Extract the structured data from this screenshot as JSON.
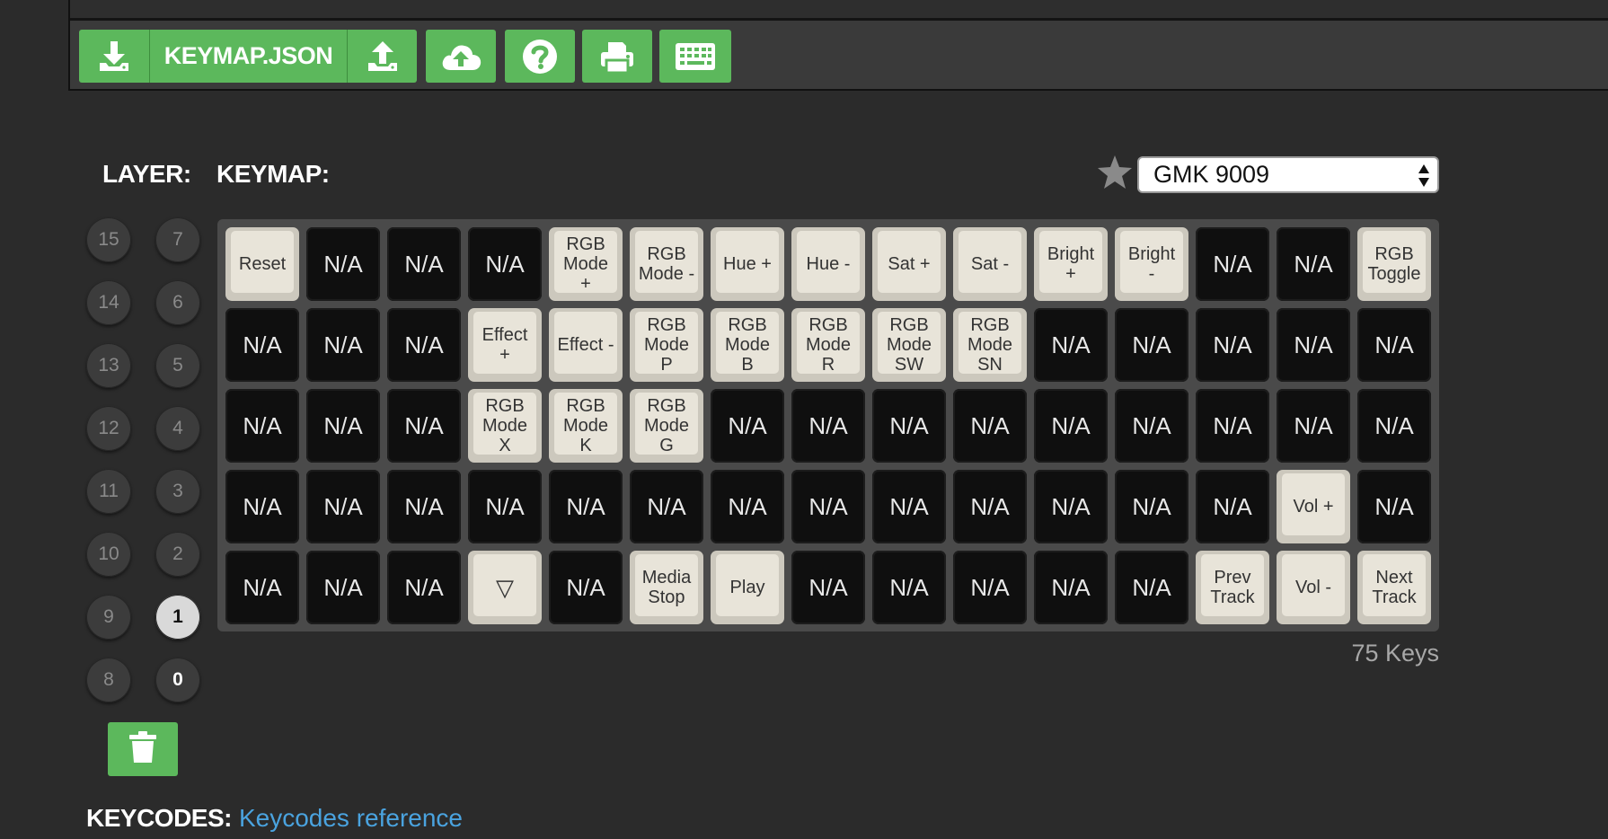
{
  "toolbar": {
    "download_icon": "download-icon",
    "file_label": "KEYMAP.JSON",
    "upload_icon": "upload-icon",
    "cloud_icon": "cloud-upload-icon",
    "help_icon": "question-icon",
    "print_icon": "print-icon",
    "keyboard_icon": "keyboard-icon",
    "accent_color": "#5cb85c"
  },
  "layer_section": {
    "heading": "LAYER:",
    "layers_left": [
      "15",
      "14",
      "13",
      "12",
      "11",
      "10",
      "9",
      "8"
    ],
    "layers_right": [
      "7",
      "6",
      "5",
      "4",
      "3",
      "2",
      "1",
      "0"
    ],
    "selected_layer": "1",
    "trash_icon": "trash-icon"
  },
  "keymap_section": {
    "heading": "KEYMAP:",
    "favorite_icon": "star-icon",
    "keyboard_select_value": "GMK 9009",
    "key_count": "75 Keys",
    "rows": [
      [
        {
          "label": "Reset",
          "style": "light"
        },
        {
          "label": "N/A",
          "style": "dark"
        },
        {
          "label": "N/A",
          "style": "dark"
        },
        {
          "label": "N/A",
          "style": "dark"
        },
        {
          "label": "RGB\nMode\n+",
          "style": "light"
        },
        {
          "label": "RGB\nMode -",
          "style": "light"
        },
        {
          "label": "Hue +",
          "style": "light"
        },
        {
          "label": "Hue -",
          "style": "light"
        },
        {
          "label": "Sat +",
          "style": "light"
        },
        {
          "label": "Sat -",
          "style": "light"
        },
        {
          "label": "Bright\n+",
          "style": "light"
        },
        {
          "label": "Bright\n-",
          "style": "light"
        },
        {
          "label": "N/A",
          "style": "dark"
        },
        {
          "label": "N/A",
          "style": "dark"
        },
        {
          "label": "RGB\nToggle",
          "style": "light"
        }
      ],
      [
        {
          "label": "N/A",
          "style": "dark"
        },
        {
          "label": "N/A",
          "style": "dark"
        },
        {
          "label": "N/A",
          "style": "dark"
        },
        {
          "label": "Effect\n+",
          "style": "light"
        },
        {
          "label": "Effect -",
          "style": "light"
        },
        {
          "label": "RGB\nMode\nP",
          "style": "light"
        },
        {
          "label": "RGB\nMode\nB",
          "style": "light"
        },
        {
          "label": "RGB\nMode\nR",
          "style": "light"
        },
        {
          "label": "RGB\nMode\nSW",
          "style": "light"
        },
        {
          "label": "RGB\nMode\nSN",
          "style": "light"
        },
        {
          "label": "N/A",
          "style": "dark"
        },
        {
          "label": "N/A",
          "style": "dark"
        },
        {
          "label": "N/A",
          "style": "dark"
        },
        {
          "label": "N/A",
          "style": "dark"
        },
        {
          "label": "N/A",
          "style": "dark"
        }
      ],
      [
        {
          "label": "N/A",
          "style": "dark"
        },
        {
          "label": "N/A",
          "style": "dark"
        },
        {
          "label": "N/A",
          "style": "dark"
        },
        {
          "label": "RGB\nMode\nX",
          "style": "light"
        },
        {
          "label": "RGB\nMode\nK",
          "style": "light"
        },
        {
          "label": "RGB\nMode\nG",
          "style": "light"
        },
        {
          "label": "N/A",
          "style": "dark"
        },
        {
          "label": "N/A",
          "style": "dark"
        },
        {
          "label": "N/A",
          "style": "dark"
        },
        {
          "label": "N/A",
          "style": "dark"
        },
        {
          "label": "N/A",
          "style": "dark"
        },
        {
          "label": "N/A",
          "style": "dark"
        },
        {
          "label": "N/A",
          "style": "dark"
        },
        {
          "label": "N/A",
          "style": "dark"
        },
        {
          "label": "N/A",
          "style": "dark"
        }
      ],
      [
        {
          "label": "N/A",
          "style": "dark"
        },
        {
          "label": "N/A",
          "style": "dark"
        },
        {
          "label": "N/A",
          "style": "dark"
        },
        {
          "label": "N/A",
          "style": "dark"
        },
        {
          "label": "N/A",
          "style": "dark"
        },
        {
          "label": "N/A",
          "style": "dark"
        },
        {
          "label": "N/A",
          "style": "dark"
        },
        {
          "label": "N/A",
          "style": "dark"
        },
        {
          "label": "N/A",
          "style": "dark"
        },
        {
          "label": "N/A",
          "style": "dark"
        },
        {
          "label": "N/A",
          "style": "dark"
        },
        {
          "label": "N/A",
          "style": "dark"
        },
        {
          "label": "N/A",
          "style": "dark"
        },
        {
          "label": "Vol +",
          "style": "light"
        },
        {
          "label": "N/A",
          "style": "dark"
        }
      ],
      [
        {
          "label": "N/A",
          "style": "dark"
        },
        {
          "label": "N/A",
          "style": "dark"
        },
        {
          "label": "N/A",
          "style": "dark"
        },
        {
          "label": "▽",
          "style": "light"
        },
        {
          "label": "N/A",
          "style": "dark"
        },
        {
          "label": "Media\nStop",
          "style": "light"
        },
        {
          "label": "Play",
          "style": "light"
        },
        {
          "label": "N/A",
          "style": "dark"
        },
        {
          "label": "N/A",
          "style": "dark"
        },
        {
          "label": "N/A",
          "style": "dark"
        },
        {
          "label": "N/A",
          "style": "dark"
        },
        {
          "label": "N/A",
          "style": "dark"
        },
        {
          "label": "Prev\nTrack",
          "style": "light"
        },
        {
          "label": "Vol -",
          "style": "light"
        },
        {
          "label": "Next\nTrack",
          "style": "light"
        }
      ]
    ]
  },
  "keycodes": {
    "heading": "KEYCODES:",
    "link_label": "Keycodes reference"
  }
}
